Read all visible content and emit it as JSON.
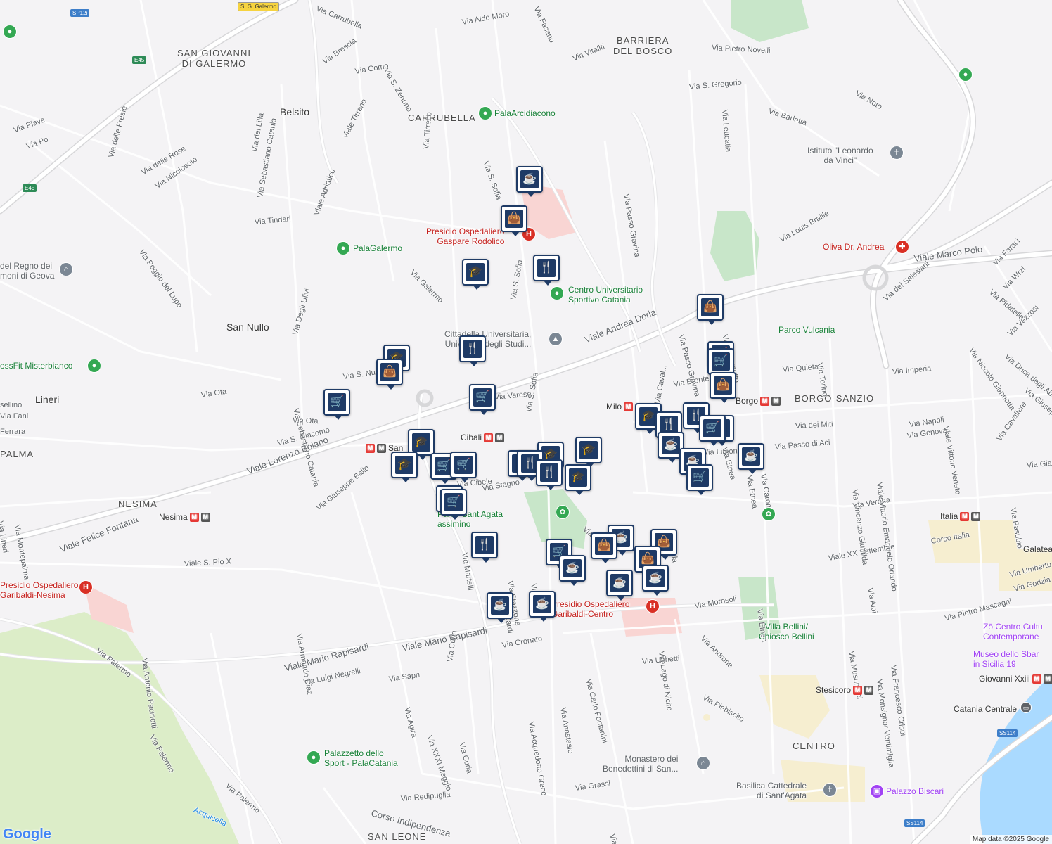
{
  "attribution": "Map data ©2025 Google",
  "logo": "Google",
  "areas": [
    {
      "id": "barriera",
      "text": "BARRIERA\nDEL BOSCO"
    },
    {
      "id": "sangiovanni",
      "text": "SAN GIOVANNI\nDI GALERMO"
    },
    {
      "id": "carrubella",
      "text": "CARRUBELLA"
    },
    {
      "id": "borgosanzio",
      "text": "BORGO-SANZIO"
    },
    {
      "id": "nesima",
      "text": "NESIMA"
    },
    {
      "id": "palma",
      "text": "PALMA"
    },
    {
      "id": "centro",
      "text": "CENTRO"
    },
    {
      "id": "sanleone",
      "text": "SAN LEONE"
    }
  ],
  "places": [
    {
      "id": "belsito",
      "text": "Belsito"
    },
    {
      "id": "sannullo",
      "text": "San Nullo"
    },
    {
      "id": "lineri",
      "text": "Lineri"
    }
  ],
  "streets": [
    {
      "id": "s1",
      "text": "Via Carrubella"
    },
    {
      "id": "s2",
      "text": "Via Aldo Moro"
    },
    {
      "id": "s3",
      "text": "Via Fasano"
    },
    {
      "id": "s4",
      "text": "Via Vitaliti"
    },
    {
      "id": "s5",
      "text": "Via Pietro Novelli"
    },
    {
      "id": "s6",
      "text": "Via S. Gregorio"
    },
    {
      "id": "s7",
      "text": "Via Leucatia"
    },
    {
      "id": "s8",
      "text": "Via Barletta"
    },
    {
      "id": "s9",
      "text": "Via Noto"
    },
    {
      "id": "s10",
      "text": "Via Brescia"
    },
    {
      "id": "s11",
      "text": "Via Como"
    },
    {
      "id": "s12",
      "text": "Via S. Zenone"
    },
    {
      "id": "s13",
      "text": "Viale Tirreno"
    },
    {
      "id": "s14",
      "text": "Via Tirreno"
    },
    {
      "id": "s15",
      "text": "Via S. Sofia"
    },
    {
      "id": "s16",
      "text": "Via Piave"
    },
    {
      "id": "s17",
      "text": "Via Po"
    },
    {
      "id": "s18",
      "text": "Via delle Fresie"
    },
    {
      "id": "s19",
      "text": "Via dei Lilla"
    },
    {
      "id": "s20",
      "text": "Via delle Rose"
    },
    {
      "id": "s21",
      "text": "Via Nicolosoto"
    },
    {
      "id": "s22",
      "text": "Via Sebastiano Catania"
    },
    {
      "id": "s23",
      "text": "Viale Adriatico"
    },
    {
      "id": "s24",
      "text": "Via Tindari"
    },
    {
      "id": "s25",
      "text": "Via Poggio del Lupo"
    },
    {
      "id": "s26",
      "text": "Via Galermo"
    },
    {
      "id": "s27",
      "text": "Via S. Sofia"
    },
    {
      "id": "s28",
      "text": "Via Passo Gravina"
    },
    {
      "id": "s29",
      "text": "Via Louis Braille"
    },
    {
      "id": "s30",
      "text": "Viale Marco Polo"
    },
    {
      "id": "s31",
      "text": "Viale Andrea Doria"
    },
    {
      "id": "s32",
      "text": "Via Palazzotto"
    },
    {
      "id": "s33",
      "text": "Via dei Salesiani"
    },
    {
      "id": "s34",
      "text": "Via Faraci"
    },
    {
      "id": "s35",
      "text": "Via Wrzi"
    },
    {
      "id": "s36",
      "text": "Via Pidatella"
    },
    {
      "id": "s37",
      "text": "Via Vezzosi"
    },
    {
      "id": "s38",
      "text": "Via Niccolò Giannotta"
    },
    {
      "id": "s39",
      "text": "Via Duca degli Abruzzi"
    },
    {
      "id": "s40",
      "text": "Via Giuseppe"
    },
    {
      "id": "s41",
      "text": "Via Degli Ulivi"
    },
    {
      "id": "s42",
      "text": "Via S. Nullo"
    },
    {
      "id": "s43",
      "text": "Via Ota"
    },
    {
      "id": "s44",
      "text": "Via Ota"
    },
    {
      "id": "s45",
      "text": "Via S. Giacomo"
    },
    {
      "id": "s46",
      "text": "Via Sebastiano Catania"
    },
    {
      "id": "s47",
      "text": "Via Varese"
    },
    {
      "id": "s48",
      "text": "Via S. Sofia"
    },
    {
      "id": "s49",
      "text": "Via Bronte"
    },
    {
      "id": "s50",
      "text": "Via Quieta"
    },
    {
      "id": "s51",
      "text": "Via Imperia"
    },
    {
      "id": "s52",
      "text": "Via Torino"
    },
    {
      "id": "s53",
      "text": "Via Passo Gravina"
    },
    {
      "id": "s54",
      "text": "Via Caval..."
    },
    {
      "id": "s55",
      "text": "Via dei Miti"
    },
    {
      "id": "s56",
      "text": "Via Passo di Aci"
    },
    {
      "id": "s57",
      "text": "Via Napoli"
    },
    {
      "id": "s58",
      "text": "Via Genova"
    },
    {
      "id": "s59",
      "text": "Via Limoni"
    },
    {
      "id": "s60",
      "text": "Via Caronda"
    },
    {
      "id": "s61",
      "text": "Via Etnea"
    },
    {
      "id": "s62",
      "text": "Viale Vittorio Veneto"
    },
    {
      "id": "s63",
      "text": "Via Cavaliere"
    },
    {
      "id": "s64",
      "text": "Via Giac..."
    },
    {
      "id": "s65",
      "text": "Viale Lorenzo Bolano"
    },
    {
      "id": "s66",
      "text": "Via Cibele"
    },
    {
      "id": "s67",
      "text": "Via Stagno"
    },
    {
      "id": "s68",
      "text": "Via Giuseppe Ballo"
    },
    {
      "id": "s69",
      "text": "Via Lineri"
    },
    {
      "id": "s70",
      "text": "Via Montepalma"
    },
    {
      "id": "s71",
      "text": "Viale Felice Fontana"
    },
    {
      "id": "s72",
      "text": "Viale S. Pio X"
    },
    {
      "id": "s73",
      "text": "Via Verona"
    },
    {
      "id": "s74",
      "text": "Viale XX Settembre"
    },
    {
      "id": "s75",
      "text": "Corso Italia"
    },
    {
      "id": "s76",
      "text": "Via Aloi"
    },
    {
      "id": "s77",
      "text": "Via Umberto"
    },
    {
      "id": "s78",
      "text": "Via Gorizia"
    },
    {
      "id": "s79",
      "text": "Via Pietro Mascagni"
    },
    {
      "id": "s80",
      "text": "Via Musumeci"
    },
    {
      "id": "s81",
      "text": "Via Francesco Crispi"
    },
    {
      "id": "s82",
      "text": "Via Monsignor Ventimiglia"
    },
    {
      "id": "s83",
      "text": "Viale Vittorio Emanuele Orlando"
    },
    {
      "id": "s84",
      "text": "Via Vincenzo Giuffrida"
    },
    {
      "id": "s85",
      "text": "Via Pasubio"
    },
    {
      "id": "s86",
      "text": "Via Morosoli"
    },
    {
      "id": "s87",
      "text": "Via Androne"
    },
    {
      "id": "s88",
      "text": "Via Ughetti"
    },
    {
      "id": "s89",
      "text": "Via Lago di Nicito"
    },
    {
      "id": "s90",
      "text": "Via Plebiscito"
    },
    {
      "id": "s91",
      "text": "Via Etnea"
    },
    {
      "id": "s92",
      "text": "Via Cronato"
    },
    {
      "id": "s93",
      "text": "Viale Mario Rapisardi"
    },
    {
      "id": "s94",
      "text": "Viale Mario Rapisardi"
    },
    {
      "id": "s95",
      "text": "Via Luigi Negrelli"
    },
    {
      "id": "s96",
      "text": "Via Sapri"
    },
    {
      "id": "s97",
      "text": "Via Curia"
    },
    {
      "id": "s98",
      "text": "Via Agira"
    },
    {
      "id": "s99",
      "text": "Via XXXI Maggio"
    },
    {
      "id": "s100",
      "text": "Via Curia"
    },
    {
      "id": "s101",
      "text": "Via Acquedotto Greco"
    },
    {
      "id": "s102",
      "text": "Via Anastasio"
    },
    {
      "id": "s103",
      "text": "Via Carlo Fontanini"
    },
    {
      "id": "s104",
      "text": "Via Martelli"
    },
    {
      "id": "s105",
      "text": "Via Stazzone"
    },
    {
      "id": "s106",
      "text": "Via Cardi"
    },
    {
      "id": "s107",
      "text": "Via Palermo"
    },
    {
      "id": "s108",
      "text": "Via Palermo"
    },
    {
      "id": "s109",
      "text": "Via Palermo"
    },
    {
      "id": "s110",
      "text": "Via Antonio Pacinotti"
    },
    {
      "id": "s111",
      "text": "Via Armando Diaz"
    },
    {
      "id": "s112",
      "text": "Via Redipuglia"
    },
    {
      "id": "s113",
      "text": "Corso Indipendenza"
    },
    {
      "id": "s114",
      "text": "Via Grassi"
    },
    {
      "id": "s115",
      "text": "Via Plebiscito"
    },
    {
      "id": "s116",
      "text": "Acquicella"
    },
    {
      "id": "s117",
      "text": "Via Fani"
    },
    {
      "id": "s118",
      "text": "Ferrara"
    },
    {
      "id": "s119",
      "text": "sellino"
    },
    {
      "id": "s120",
      "text": "Via Ala"
    },
    {
      "id": "s121",
      "text": "Via V..."
    },
    {
      "id": "s122",
      "text": "Via Etnea"
    },
    {
      "id": "s123",
      "text": "Via Sta..."
    }
  ],
  "pois": [
    {
      "id": "palaarcidiacono",
      "text": "PalaArcidiacono",
      "color": "green",
      "icon": "park-icon"
    },
    {
      "id": "palagalermo",
      "text": "PalaGalermo",
      "color": "green",
      "icon": "park-icon"
    },
    {
      "id": "presidio1",
      "text": "Presidio Ospedaliero\nGaspare Rodolico",
      "color": "red",
      "icon": "hospital-icon"
    },
    {
      "id": "cus",
      "text": "Centro Universitario\nSportivo Catania",
      "color": "green",
      "icon": "park-icon"
    },
    {
      "id": "cittadella",
      "text": "Cittadella Universitaria,\nUniversità degli Studi...",
      "color": "gray",
      "icon": "school-icon"
    },
    {
      "id": "istituto",
      "text": "Istituto \"Leonardo\nda Vinci\"",
      "color": "gray",
      "icon": "church-icon"
    },
    {
      "id": "oliva",
      "text": "Oliva Dr. Andrea",
      "color": "red",
      "icon": "medical-icon"
    },
    {
      "id": "parco",
      "text": "Parco Vulcania",
      "color": "green",
      "icon": ""
    },
    {
      "id": "regno",
      "text": "del Regno dei\nmoni di Geova",
      "color": "gray",
      "icon": "church-icon"
    },
    {
      "id": "crossfit",
      "text": "ossFit Misterbianco",
      "color": "green",
      "icon": "park-icon"
    },
    {
      "id": "santa",
      "text": "Parco Sant'Agata\nassimino",
      "color": "green",
      "icon": "zoo-icon"
    },
    {
      "id": "presidio2",
      "text": "Presidio Ospedaliero\nGaribaldi-Centro",
      "color": "red",
      "icon": "hospital-icon"
    },
    {
      "id": "presidio3",
      "text": "Presidio Ospedaliero\nGaribaldi-Nesima",
      "color": "red",
      "icon": "hospital-icon"
    },
    {
      "id": "villa",
      "text": "Villa Bellini/\nChiosco Bellini",
      "color": "green",
      "icon": ""
    },
    {
      "id": "zo",
      "text": "Zō Centro Cultu\nContemporane",
      "color": "purple",
      "icon": ""
    },
    {
      "id": "museo",
      "text": "Museo dello Sbar\nin Sicilia 19",
      "color": "purple",
      "icon": ""
    },
    {
      "id": "palazzetto",
      "text": "Palazzetto dello\nSport - PalaCatania",
      "color": "green",
      "icon": "park-icon"
    },
    {
      "id": "monastero",
      "text": "Monastero dei\nBenedettini di San...",
      "color": "gray",
      "icon": "museum-icon"
    },
    {
      "id": "basilica",
      "text": "Basilica Cattedrale\ndi Sant'Agata",
      "color": "gray",
      "icon": "church-icon"
    },
    {
      "id": "biscari",
      "text": "Palazzo Biscari",
      "color": "purple",
      "icon": "landmark-icon"
    },
    {
      "id": "catcentrale",
      "text": "Catania Centrale",
      "color": "gray",
      "icon": "train-icon"
    }
  ],
  "metro": [
    {
      "id": "milo",
      "text": "Milo"
    },
    {
      "id": "borgo",
      "text": "Borgo"
    },
    {
      "id": "cibali",
      "text": "Cibali"
    },
    {
      "id": "sannullo",
      "text": "San"
    },
    {
      "id": "nesima",
      "text": "Nesima"
    },
    {
      "id": "italia",
      "text": "Italia"
    },
    {
      "id": "galatea",
      "text": "Galatea"
    },
    {
      "id": "stesicoro",
      "text": "Stesicoro"
    },
    {
      "id": "giovanni",
      "text": "Giovanni Xxiii"
    }
  ],
  "shields": [
    {
      "id": "sp12i",
      "text": "SP12i"
    },
    {
      "id": "e45a",
      "text": "E45"
    },
    {
      "id": "e45b",
      "text": "E45"
    },
    {
      "id": "sgg",
      "text": "S. G. Galermo"
    },
    {
      "id": "ss114a",
      "text": "SS114"
    },
    {
      "id": "ss114b",
      "text": "SS114"
    }
  ],
  "markers": [
    {
      "type": "cafe"
    },
    {
      "type": "shopping"
    },
    {
      "type": "restaurant"
    },
    {
      "type": "school"
    },
    {
      "type": "restaurant"
    },
    {
      "type": "school"
    },
    {
      "type": "shopping"
    },
    {
      "type": "grocery"
    },
    {
      "type": "grocery"
    },
    {
      "type": "shopping"
    },
    {
      "type": "school"
    },
    {
      "type": "school"
    },
    {
      "type": "grocery"
    },
    {
      "type": "grocery"
    },
    {
      "type": "grocery"
    },
    {
      "type": "grocery"
    },
    {
      "type": "school"
    },
    {
      "type": "restaurant"
    },
    {
      "type": "restaurant"
    },
    {
      "type": "school"
    },
    {
      "type": "restaurant"
    },
    {
      "type": "school"
    },
    {
      "type": "school"
    },
    {
      "type": "restaurant"
    },
    {
      "type": "grocery"
    },
    {
      "type": "grocery"
    },
    {
      "type": "cafe"
    },
    {
      "type": "cafe"
    },
    {
      "type": "grocery"
    },
    {
      "type": "cafe"
    },
    {
      "type": "shopping"
    },
    {
      "type": "grocery"
    },
    {
      "type": "restaurant"
    },
    {
      "type": "restaurant"
    },
    {
      "type": "grocery"
    },
    {
      "type": "cafe"
    },
    {
      "type": "shopping"
    },
    {
      "type": "cafe"
    },
    {
      "type": "shopping"
    },
    {
      "type": "shopping"
    },
    {
      "type": "cafe"
    },
    {
      "type": "cafe"
    },
    {
      "type": "cafe"
    },
    {
      "type": "cafe"
    },
    {
      "type": "school"
    }
  ],
  "colors": {
    "marker": "#1f3b66",
    "water": "#aadaff",
    "park": "#c8e6c9",
    "hospital": "#f9d5d3",
    "highway": "#ffffff",
    "highway_edge": "#d7d7d9"
  }
}
